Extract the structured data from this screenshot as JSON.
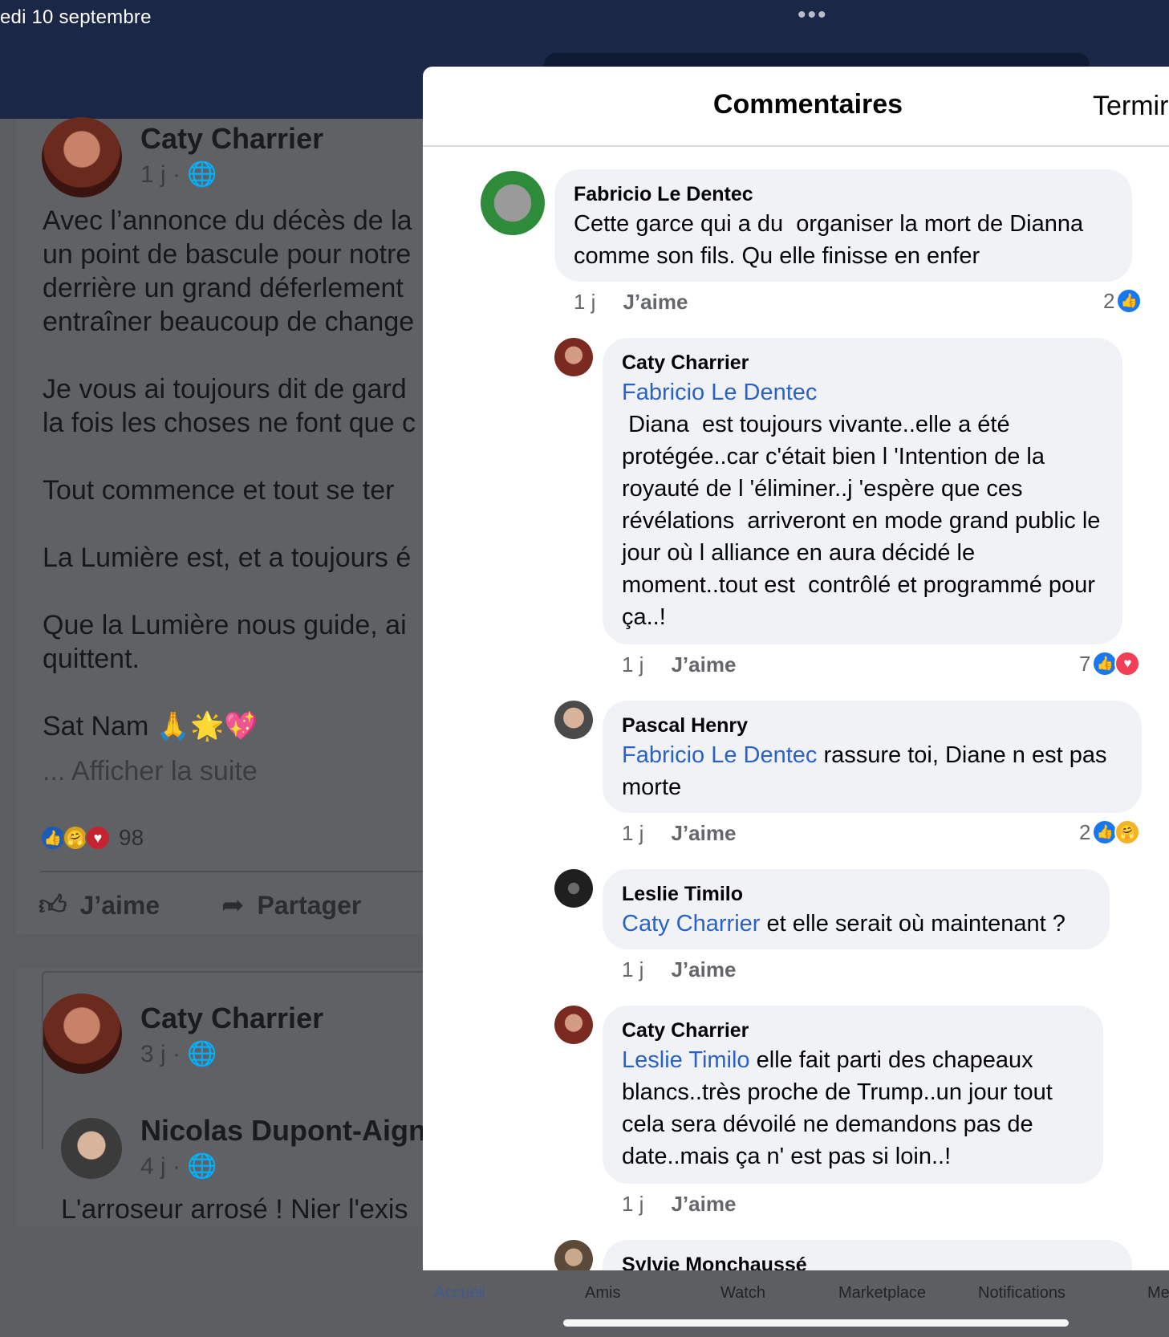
{
  "status": {
    "date": "edi 10 septembre",
    "dots": "•••"
  },
  "feed": {
    "post1": {
      "author": "Caty Charrier",
      "meta": "1 j · 🌐",
      "text": "Avec l’annonce du décès de la\nun point de bascule pour notre\nderrière un grand déferlement\nentraîner beaucoup de change\n\nJe vous ai toujours dit de gard\nla fois les choses ne font que c\n\nTout commence et tout se ter\n\nLa Lumière est, et a toujours é\n\nQue la Lumière nous guide, ai\nquittent.\n\nSat Nam 🙏🌟💖",
      "more": "... Afficher la suite",
      "reaction_count": "98",
      "like_label": "J’aime",
      "share_label": "Partager"
    },
    "post2": {
      "author": "Caty Charrier",
      "meta": "3 j · 🌐",
      "shared_author": "Nicolas Dupont-Aigna",
      "shared_meta": "4 j · 🌐",
      "shared_text": "L'arroseur arrosé ! Nier l'exis"
    }
  },
  "tabbar": {
    "tabs": [
      "Accueil",
      "Amis",
      "Watch",
      "Marketplace",
      "Notifications",
      "Me"
    ]
  },
  "modal": {
    "title": "Commentaires",
    "done_label": "Termir"
  },
  "comments": [
    {
      "author": "Fabricio Le Dentec",
      "tag": "",
      "text": "Cette garce qui a du  organiser la mort de Dianna comme son fils. Qu elle finisse en enfer",
      "time": "1 j",
      "like": "J’aime",
      "reaction_count": "2",
      "reactions": [
        "like-icon"
      ]
    },
    {
      "author": "Caty Charrier",
      "tag": "Fabricio Le Dentec",
      "text": " Diana  est toujours vivante..elle a été protégée..car c'était bien l 'Intention de la royauté de l 'éliminer..j 'espère que ces révélations  arriveront en mode grand public le jour où l alliance en aura décidé le moment..tout est  contrôlé et programmé pour ça..!",
      "time": "1 j",
      "like": "J’aime",
      "reaction_count": "7",
      "reactions": [
        "like-icon",
        "love-icon"
      ]
    },
    {
      "author": "Pascal Henry",
      "tag": "Fabricio Le Dentec",
      "text": " rassure toi, Diane n est pas morte",
      "time": "1 j",
      "like": "J’aime",
      "reaction_count": "2",
      "reactions": [
        "like-icon",
        "care-icon"
      ]
    },
    {
      "author": "Leslie Timilo",
      "tag": "Caty Charrier",
      "text": " et elle serait où maintenant ?",
      "time": "1 j",
      "like": "J’aime",
      "reaction_count": "",
      "reactions": []
    },
    {
      "author": "Caty Charrier",
      "tag": "Leslie Timilo",
      "text": " elle fait parti des chapeaux blancs..très proche de Trump..un jour tout cela sera dévoilé ne demandons pas de date..mais ça n' est pas si loin..!",
      "time": "1 j",
      "like": "J’aime",
      "reaction_count": "",
      "reactions": []
    },
    {
      "author": "Sylvie Monchaussé",
      "tag": "",
      "text": "",
      "time": "",
      "like": "",
      "reaction_count": "",
      "reactions": []
    }
  ],
  "colors": {
    "accent": "#1877f2",
    "tag": "#2a62c8",
    "bubble": "#f0f2f5",
    "topbar": "#1b2747"
  }
}
